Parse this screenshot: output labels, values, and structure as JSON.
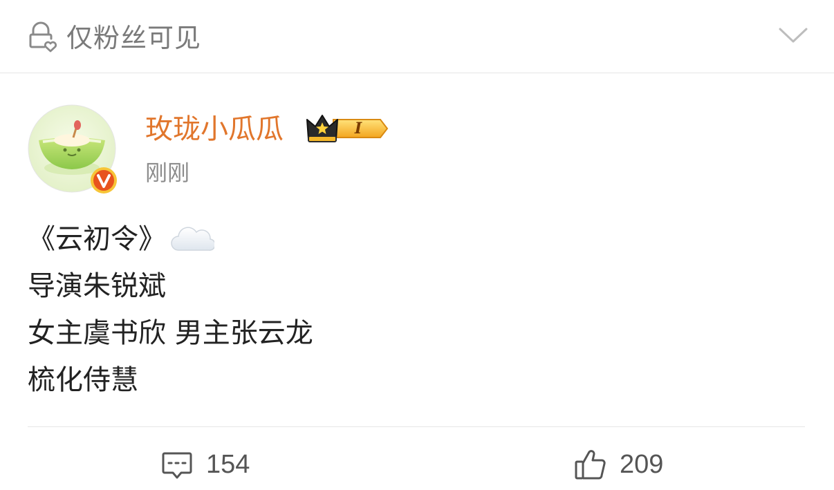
{
  "visibility": {
    "label": "仅粉丝可见",
    "icon": "lock-heart-icon",
    "expand_icon": "chevron-down-icon"
  },
  "post": {
    "author": {
      "name": "玫珑小瓜瓜",
      "level_badge": "I",
      "verified": true,
      "avatar": "melon-avatar"
    },
    "timestamp": "刚刚",
    "content_lines": [
      "《云初令》",
      "导演朱锐斌",
      "女主虞书欣 男主张云龙",
      "梳化侍慧"
    ],
    "emoji": "cloud-emoji"
  },
  "actions": {
    "comments": {
      "icon": "comment-icon",
      "count": "154"
    },
    "likes": {
      "icon": "thumbs-up-icon",
      "count": "209"
    }
  },
  "colors": {
    "username": "#e1762c",
    "secondary_text": "#8c8c8c",
    "body_text": "#222222",
    "divider": "#e6e6e6",
    "verified_badge": "#e8541e"
  }
}
